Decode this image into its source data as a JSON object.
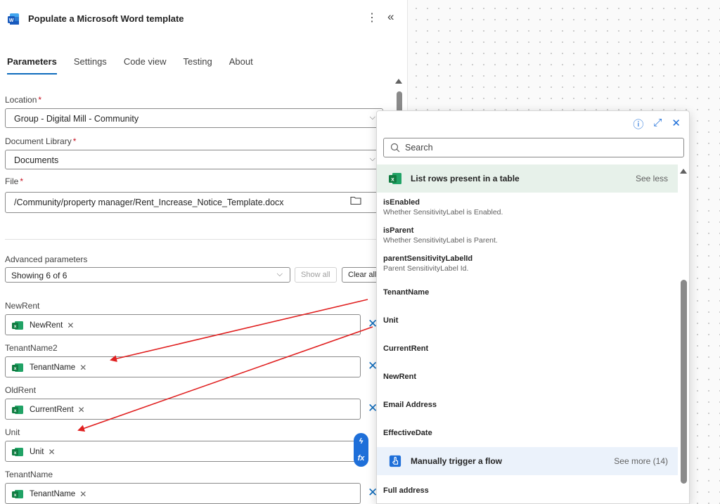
{
  "header": {
    "title": "Populate a Microsoft Word template",
    "more": "⋮",
    "collapse": "«"
  },
  "tabs": [
    "Parameters",
    "Settings",
    "Code view",
    "Testing",
    "About"
  ],
  "fields": {
    "location": {
      "label": "Location",
      "required": "*",
      "value": "Group - Digital Mill - Community"
    },
    "library": {
      "label": "Document Library",
      "required": "*",
      "value": "Documents"
    },
    "file": {
      "label": "File",
      "required": "*",
      "value": "/Community/property manager/Rent_Increase_Notice_Template.docx"
    }
  },
  "advanced": {
    "label": "Advanced parameters",
    "value": "Showing 6 of 6",
    "show_all": "Show all",
    "clear_all": "Clear all"
  },
  "params": [
    {
      "label": "NewRent",
      "token": "NewRent"
    },
    {
      "label": "TenantName2",
      "token": "TenantName"
    },
    {
      "label": "OldRent",
      "token": "CurrentRent"
    },
    {
      "label": "Unit",
      "token": "Unit"
    },
    {
      "label": "TenantName",
      "token": "TenantName"
    }
  ],
  "token_remove": "✕",
  "clear_x": "✕",
  "fab": {
    "top": "ϟ",
    "bottom": "fx"
  },
  "popup": {
    "icons": {
      "info": "ⓘ",
      "expand": "⤢",
      "close": "✕"
    },
    "search_placeholder": "Search",
    "excel_section": {
      "title": "List rows present in a table",
      "more": "See less"
    },
    "items": [
      {
        "name": "isEnabled",
        "desc": "Whether SensitivityLabel is Enabled."
      },
      {
        "name": "isParent",
        "desc": "Whether SensitivityLabel is Parent."
      },
      {
        "name": "parentSensitivityLabelId",
        "desc": "Parent SensitivityLabel Id."
      },
      {
        "name": "TenantName",
        "desc": ""
      },
      {
        "name": "Unit",
        "desc": ""
      },
      {
        "name": "CurrentRent",
        "desc": ""
      },
      {
        "name": "NewRent",
        "desc": ""
      },
      {
        "name": "Email Address",
        "desc": ""
      },
      {
        "name": "EffectiveDate",
        "desc": ""
      }
    ],
    "manual_section": {
      "title": "Manually trigger a flow",
      "more": "See more (14)"
    },
    "manual_items": [
      {
        "name": "Full address"
      }
    ]
  },
  "colors": {
    "accent": "#0f6cbd",
    "excel": "#107c41",
    "arrow": "#e02020",
    "word": "#185abd"
  }
}
